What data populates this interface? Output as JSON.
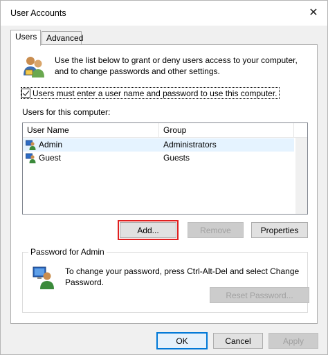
{
  "window": {
    "title": "User Accounts",
    "close_glyph": "✕"
  },
  "tabs": [
    {
      "label": "Users",
      "active": true
    },
    {
      "label": "Advanced",
      "active": false
    }
  ],
  "intro": {
    "text": "Use the list below to grant or deny users access to your computer, and to change passwords and other settings."
  },
  "require_login": {
    "label": "Users must enter a user name and password to use this computer.",
    "checked": true
  },
  "users_list": {
    "label": "Users for this computer:",
    "columns": [
      "User Name",
      "Group"
    ],
    "rows": [
      {
        "name": "Admin",
        "group": "Administrators",
        "selected": true
      },
      {
        "name": "Guest",
        "group": "Guests",
        "selected": false
      }
    ]
  },
  "buttons": {
    "add": "Add...",
    "remove": "Remove",
    "properties": "Properties"
  },
  "password_group": {
    "title": "Password for Admin",
    "text": "To change your password, press Ctrl-Alt-Del and select Change Password.",
    "reset_button": "Reset Password..."
  },
  "footer": {
    "ok": "OK",
    "cancel": "Cancel",
    "apply": "Apply"
  },
  "icons": {
    "intro": "users-group-icon",
    "user_row": "user-icon",
    "password": "user-computer-icon"
  },
  "colors": {
    "highlight": "#e02020",
    "selection": "#e5f3ff",
    "accent": "#0078d7"
  }
}
